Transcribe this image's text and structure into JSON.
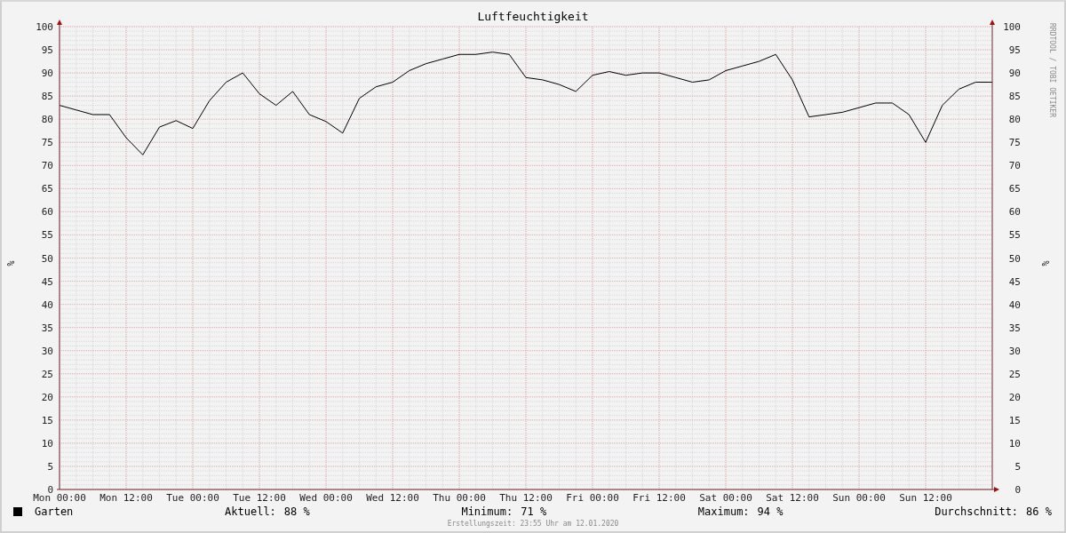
{
  "chart_data": {
    "type": "line",
    "title": "Luftfeuchtigkeit",
    "ylabel": "%",
    "categories": [
      "Mon 00:00",
      null,
      null,
      null,
      "Mon 12:00",
      null,
      null,
      null,
      "Tue 00:00",
      null,
      null,
      null,
      "Tue 12:00",
      null,
      null,
      null,
      "Wed 00:00",
      null,
      null,
      null,
      "Wed 12:00",
      null,
      null,
      null,
      "Thu 00:00",
      null,
      null,
      null,
      "Thu 12:00",
      null,
      null,
      null,
      "Fri 00:00",
      null,
      null,
      null,
      "Fri 12:00",
      null,
      null,
      null,
      "Sat 00:00",
      null,
      null,
      null,
      "Sat 12:00",
      null,
      null,
      null,
      "Sun 00:00",
      null,
      null,
      null,
      "Sun 12:00",
      null,
      null,
      null,
      null
    ],
    "series": [
      {
        "name": "Garten",
        "color": "#000000",
        "values": [
          83,
          82,
          81,
          81,
          76,
          72.3,
          78.3,
          79.7,
          78,
          84,
          88,
          90,
          85.5,
          83,
          86,
          81,
          79.5,
          77,
          84.5,
          87,
          88,
          90.5,
          92,
          93,
          94,
          94,
          94.5,
          94,
          89,
          88.5,
          87.5,
          86,
          89.5,
          90.3,
          89.5,
          90,
          90,
          89,
          88,
          88.5,
          90.5,
          91.5,
          92.5,
          94,
          88.5,
          80.5,
          81,
          81.5,
          82.5,
          83.5,
          83.5,
          81,
          75,
          83,
          86.5,
          88,
          88
        ]
      }
    ],
    "ylim": [
      0,
      100
    ],
    "grid": true,
    "yticks": [
      0,
      5,
      10,
      15,
      20,
      25,
      30,
      35,
      40,
      45,
      50,
      55,
      60,
      65,
      70,
      75,
      80,
      85,
      90,
      95,
      100
    ]
  },
  "right_axis_labels": [
    "100",
    "95",
    "90",
    "85",
    "80",
    "75",
    "70",
    "65",
    "60",
    "55",
    "50",
    "45",
    "40",
    "35",
    "30",
    "25",
    "20",
    "15",
    "10",
    "5",
    "0"
  ],
  "right_axis_title": "%",
  "watermark_side": "RRDTOOL / TOBI OETIKER",
  "legend": {
    "color": "#000000",
    "stats": [
      {
        "label": "Aktuell:",
        "value": "88 %"
      },
      {
        "label": "Minimum:",
        "value": "71 %"
      },
      {
        "label": "Maximum:",
        "value": "94 %"
      },
      {
        "label": "Durchschnitt:",
        "value": "86 %"
      }
    ]
  },
  "footer": "Erstellungszeit: 23:55 Uhr am 12.01.2020"
}
